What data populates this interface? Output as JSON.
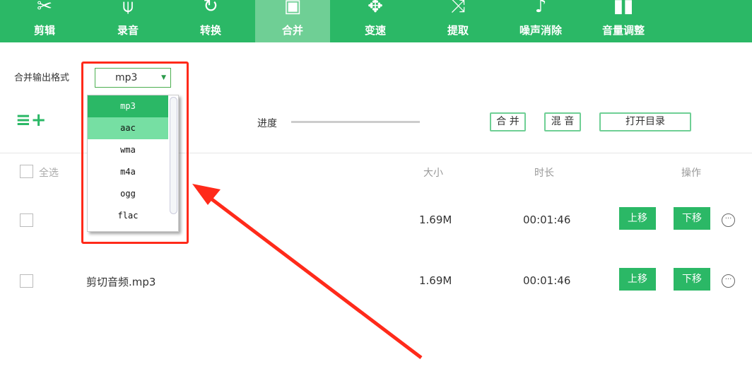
{
  "tabs": [
    {
      "label": "剪辑",
      "icon": "scissors-icon",
      "glyph": "✂"
    },
    {
      "label": "录音",
      "icon": "microphone-icon",
      "glyph": "🎙"
    },
    {
      "label": "转换",
      "icon": "convert-icon",
      "glyph": "↻"
    },
    {
      "label": "合并",
      "icon": "merge-icon",
      "glyph": "▣",
      "active": true
    },
    {
      "label": "变速",
      "icon": "speed-icon",
      "glyph": "✥"
    },
    {
      "label": "提取",
      "icon": "extract-icon",
      "glyph": "⤨"
    },
    {
      "label": "噪声消除",
      "icon": "noise-icon",
      "glyph": "♪"
    },
    {
      "label": "音量调整",
      "icon": "volume-icon",
      "glyph": "▮"
    }
  ],
  "format": {
    "label": "合并输出格式",
    "selected": "mp3",
    "options": [
      "mp3",
      "aac",
      "wma",
      "m4a",
      "ogg",
      "flac"
    ]
  },
  "toolbar": {
    "progress_label": "进度",
    "progress": 0,
    "merge": "合 并",
    "mix": "混 音",
    "open_dir": "打开目录"
  },
  "table": {
    "select_all": "全选",
    "col_size": "大小",
    "col_duration": "时长",
    "col_action": "操作",
    "rows": [
      {
        "name": "",
        "size": "1.69M",
        "duration": "00:01:46",
        "up": "上移",
        "down": "下移"
      },
      {
        "name": "剪切音频.mp3",
        "size": "1.69M",
        "duration": "00:01:46",
        "up": "上移",
        "down": "下移"
      }
    ]
  },
  "colors": {
    "brand": "#2bb866",
    "active_tab": "#6fcf95",
    "highlight": "#ff2a1a"
  }
}
